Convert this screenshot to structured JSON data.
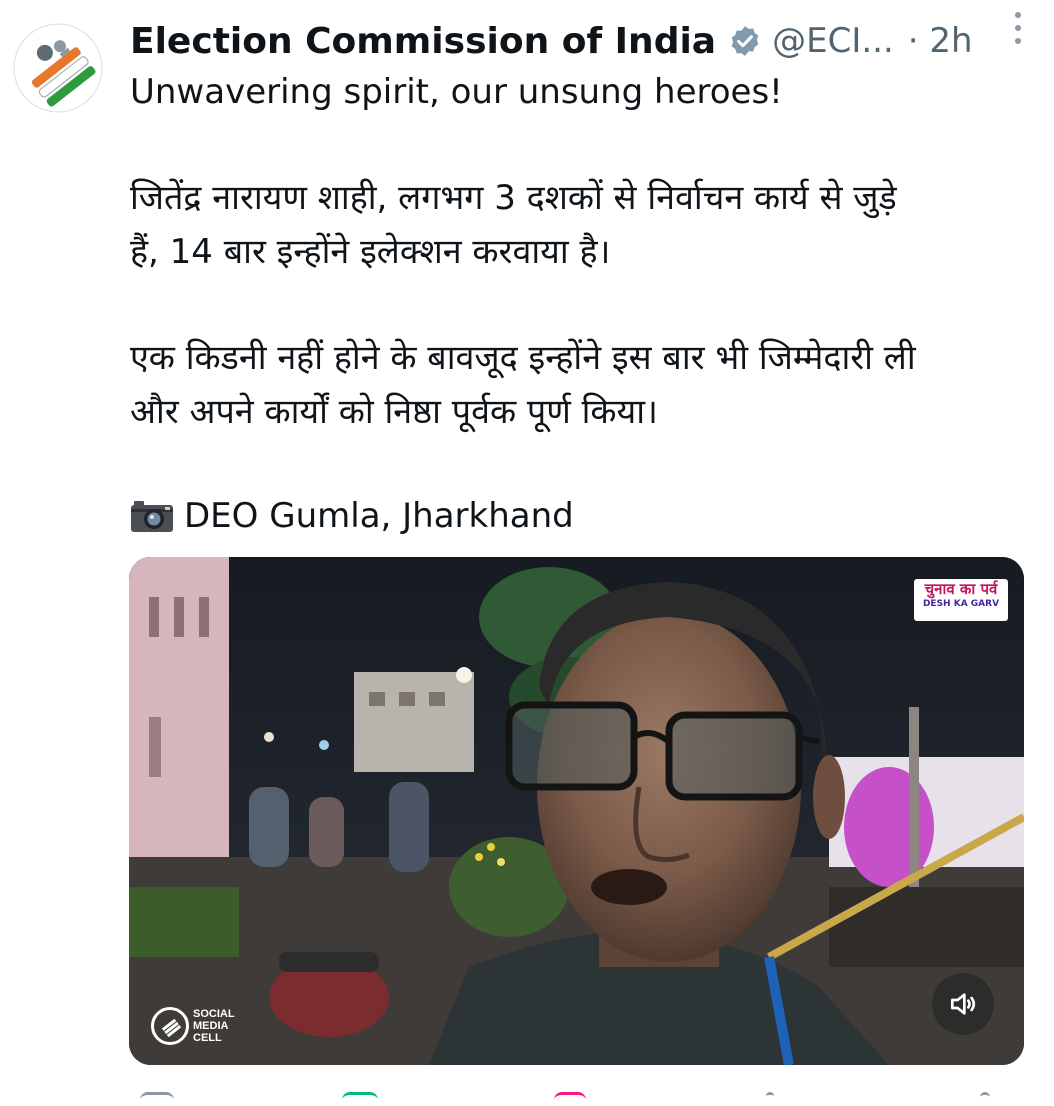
{
  "tweet": {
    "author_name": "Election Commission of India",
    "handle": "@ECI...",
    "time": "· 2h",
    "verified_color": "#829aab",
    "lines": [
      "Unwavering spirit, our unsung heroes!",
      "जितेंद्र नारायण शाही, लगभग 3 दशकों से निर्वाचन कार्य से जुड़े",
      "हैं, 14 बार इन्होंने इलेक्शन करवाया है।",
      "एक किडनी नहीं होने के बावजूद इन्होंने इस बार भी जिम्मेदारी ली",
      "और अपने कार्यों को निष्ठा पूर्वक पूर्ण किया।",
      "DEO Gumla, Jharkhand"
    ],
    "camera_icon": "camera-icon"
  },
  "media": {
    "badge_hindi": "चुनाव का पर्व",
    "badge_english": "DESH KA GARV",
    "watermark": [
      "SOCIAL",
      "MEDIA",
      "CELL"
    ],
    "mute_icon": "speaker-muted-icon"
  },
  "colors": {
    "text": "#0f1419",
    "muted": "#536471",
    "logo_orange": "#e8772e",
    "logo_green": "#2e9b3c"
  }
}
